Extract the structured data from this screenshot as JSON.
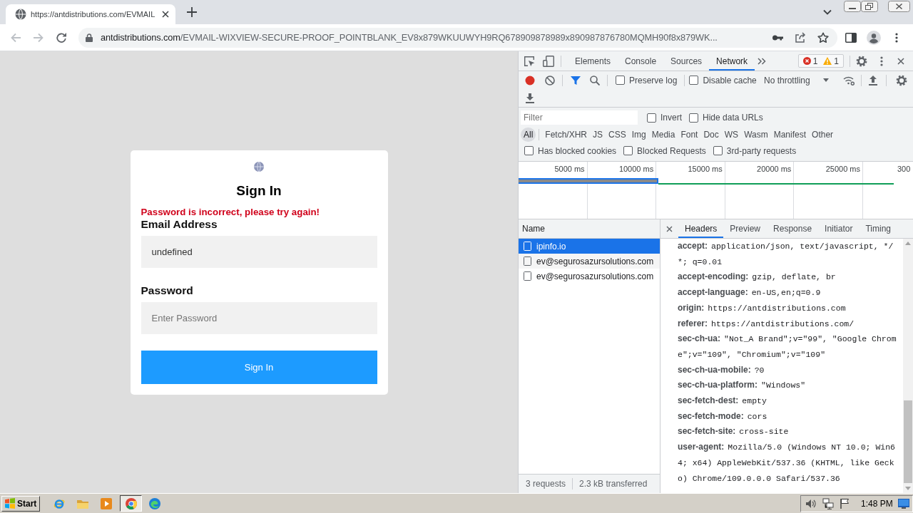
{
  "browser": {
    "tab": {
      "title": "https://antdistributions.com/EVMAIL"
    },
    "navigation": {
      "back": {
        "disabled": true
      },
      "forward": {
        "disabled": true
      }
    },
    "address_bar": {
      "host": "antdistributions.com",
      "path": "/EVMAIL-WIXVIEW-SECURE-PROOF_POINTBLANK_EV8x879WKUUWYH9RQ678909878989x890987876780MQMH90f8x879WK..."
    }
  },
  "login": {
    "title": "Sign In",
    "error": "Password is incorrect, please try again!",
    "fields": [
      {
        "label": "Email Address",
        "value": "undefined"
      },
      {
        "label": "Password",
        "placeholder": "Enter Password"
      }
    ],
    "button": "Sign In"
  },
  "devtools": {
    "tabs": [
      {
        "label": "Elements",
        "selected": false
      },
      {
        "label": "Console",
        "selected": false
      },
      {
        "label": "Sources",
        "selected": false
      },
      {
        "label": "Network",
        "selected": true
      }
    ],
    "issues": {
      "errors": "1",
      "warnings": "1"
    },
    "toolbar": {
      "options": [
        {
          "label": "Preserve log",
          "checked": false
        },
        {
          "label": "Disable cache",
          "checked": false
        }
      ],
      "throttling": "No throttling"
    },
    "filter": {
      "placeholder": "Filter",
      "options": [
        {
          "label": "Invert",
          "checked": false
        },
        {
          "label": "Hide data URLs",
          "checked": false
        }
      ]
    },
    "types": [
      {
        "label": "All",
        "selected": true
      },
      {
        "label": "Fetch/XHR",
        "selected": false
      },
      {
        "label": "JS",
        "selected": false
      },
      {
        "label": "CSS",
        "selected": false
      },
      {
        "label": "Img",
        "selected": false
      },
      {
        "label": "Media",
        "selected": false
      },
      {
        "label": "Font",
        "selected": false
      },
      {
        "label": "Doc",
        "selected": false
      },
      {
        "label": "WS",
        "selected": false
      },
      {
        "label": "Wasm",
        "selected": false
      },
      {
        "label": "Manifest",
        "selected": false
      },
      {
        "label": "Other",
        "selected": false
      }
    ],
    "request_options": [
      {
        "label": "Has blocked cookies",
        "checked": false
      },
      {
        "label": "Blocked Requests",
        "checked": false
      },
      {
        "label": "3rd-party requests",
        "checked": false
      }
    ],
    "overview": {
      "ticks": [
        "5000 ms",
        "10000 ms",
        "15000 ms",
        "20000 ms",
        "25000 ms",
        "300"
      ]
    },
    "requests": {
      "column": "Name",
      "rows": [
        {
          "name": "ipinfo.io",
          "selected": true
        },
        {
          "name": "ev@segurosazursolutions.com",
          "selected": false
        },
        {
          "name": "ev@segurosazursolutions.com",
          "selected": false
        }
      ],
      "summary": [
        "3 requests",
        "2.3 kB transferred"
      ]
    },
    "details": {
      "tabs": [
        {
          "label": "Headers",
          "selected": true
        },
        {
          "label": "Preview",
          "selected": false
        },
        {
          "label": "Response",
          "selected": false
        },
        {
          "label": "Initiator",
          "selected": false
        },
        {
          "label": "Timing",
          "selected": false
        }
      ],
      "headers": [
        {
          "name": "accept:",
          "value": "application/json, text/javascript, */*; q=0.01"
        },
        {
          "name": "accept-encoding:",
          "value": "gzip, deflate, br"
        },
        {
          "name": "accept-language:",
          "value": "en-US,en;q=0.9"
        },
        {
          "name": "origin:",
          "value": "https://antdistributions.com"
        },
        {
          "name": "referer:",
          "value": "https://antdistributions.com/"
        },
        {
          "name": "sec-ch-ua:",
          "value": "\"Not_A Brand\";v=\"99\", \"Google Chrome\";v=\"109\", \"Chromium\";v=\"109\""
        },
        {
          "name": "sec-ch-ua-mobile:",
          "value": "?0"
        },
        {
          "name": "sec-ch-ua-platform:",
          "value": "\"Windows\""
        },
        {
          "name": "sec-fetch-dest:",
          "value": "empty"
        },
        {
          "name": "sec-fetch-mode:",
          "value": "cors"
        },
        {
          "name": "sec-fetch-site:",
          "value": "cross-site"
        },
        {
          "name": "user-agent:",
          "value": "Mozilla/5.0 (Windows NT 10.0; Win64; x64) AppleWebKit/537.36 (KHTML, like Gecko) Chrome/109.0.0.0 Safari/537.36"
        }
      ]
    }
  },
  "taskbar": {
    "start": "Start",
    "clock": "1:48 PM"
  }
}
